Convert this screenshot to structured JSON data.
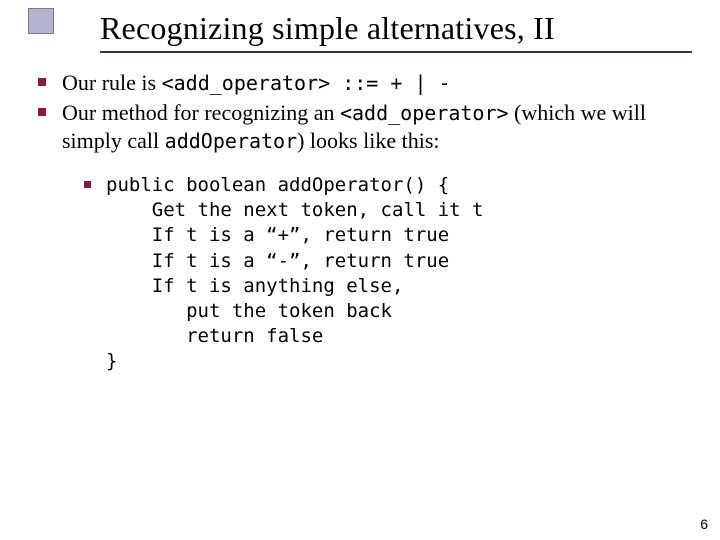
{
  "title": "Recognizing simple alternatives, II",
  "bullets": {
    "b1": {
      "pre": "Our rule is ",
      "code": "<add_operator> ::= + | -"
    },
    "b2": {
      "pre": "Our method for recognizing an ",
      "code1": "<add_operator>",
      "mid": " (which we will simply call ",
      "code2": "addOperator",
      "post": ") looks like this:"
    }
  },
  "code": {
    "l1": "public boolean addOperator() {",
    "l2": "    Get the next token, call it t",
    "l3": "    If t is a “+”, return true",
    "l4": "    If t is a “-”, return true",
    "l5": "    If t is anything else,",
    "l6": "       put the token back",
    "l7": "       return false",
    "l8": "}"
  },
  "page": "6"
}
